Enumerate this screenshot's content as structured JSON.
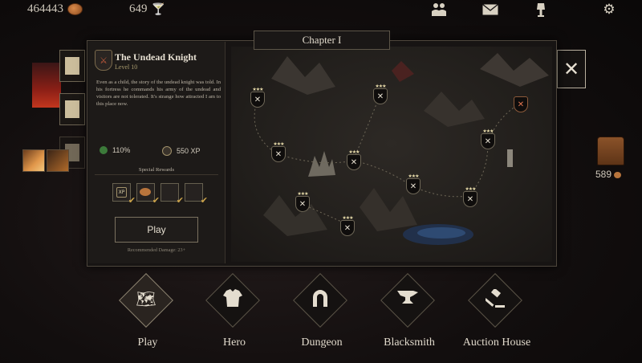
{
  "resources": {
    "gold": "464443",
    "drinks": "649"
  },
  "top_icons": [
    "friends-icon",
    "mail-icon",
    "lamp-icon",
    "gear-icon"
  ],
  "chapter": {
    "title": "Chapter I"
  },
  "level_info": {
    "name": "The Undead Knight",
    "level": "Level 10",
    "description": "Even as a child, the story of the undead knight was told. In his fortress he commands his army of the undead and visitors are not tolerated. It's strange how attracted I am to this place now.",
    "stat_percent": "110%",
    "stat_xp": "550 XP",
    "special_rewards_label": "Special Rewards",
    "rewards": [
      "xp-reward",
      "coin-reward",
      "empty-reward",
      "empty-reward"
    ],
    "play_label": "Play",
    "recommended": "Recommended Damage: 23+"
  },
  "map_nodes": [
    {
      "id": "node-1",
      "stars": 3,
      "boss": false
    },
    {
      "id": "node-2",
      "stars": 3,
      "boss": false
    },
    {
      "id": "node-3",
      "stars": 0,
      "boss": true
    },
    {
      "id": "node-4",
      "stars": 3,
      "boss": false
    },
    {
      "id": "node-5",
      "stars": 3,
      "boss": false
    },
    {
      "id": "node-6",
      "stars": 3,
      "boss": false
    },
    {
      "id": "node-7",
      "stars": 3,
      "boss": false
    },
    {
      "id": "node-8",
      "stars": 3,
      "boss": false
    },
    {
      "id": "node-9",
      "stars": 3,
      "boss": false
    },
    {
      "id": "node-10",
      "stars": 3,
      "boss": false
    }
  ],
  "chest_count": "589",
  "nav": [
    {
      "label": "Play",
      "icon": "map-icon"
    },
    {
      "label": "Hero",
      "icon": "armor-icon"
    },
    {
      "label": "Dungeon",
      "icon": "horseshoe-icon"
    },
    {
      "label": "Blacksmith",
      "icon": "anvil-icon"
    },
    {
      "label": "Auction House",
      "icon": "gavel-icon"
    }
  ]
}
